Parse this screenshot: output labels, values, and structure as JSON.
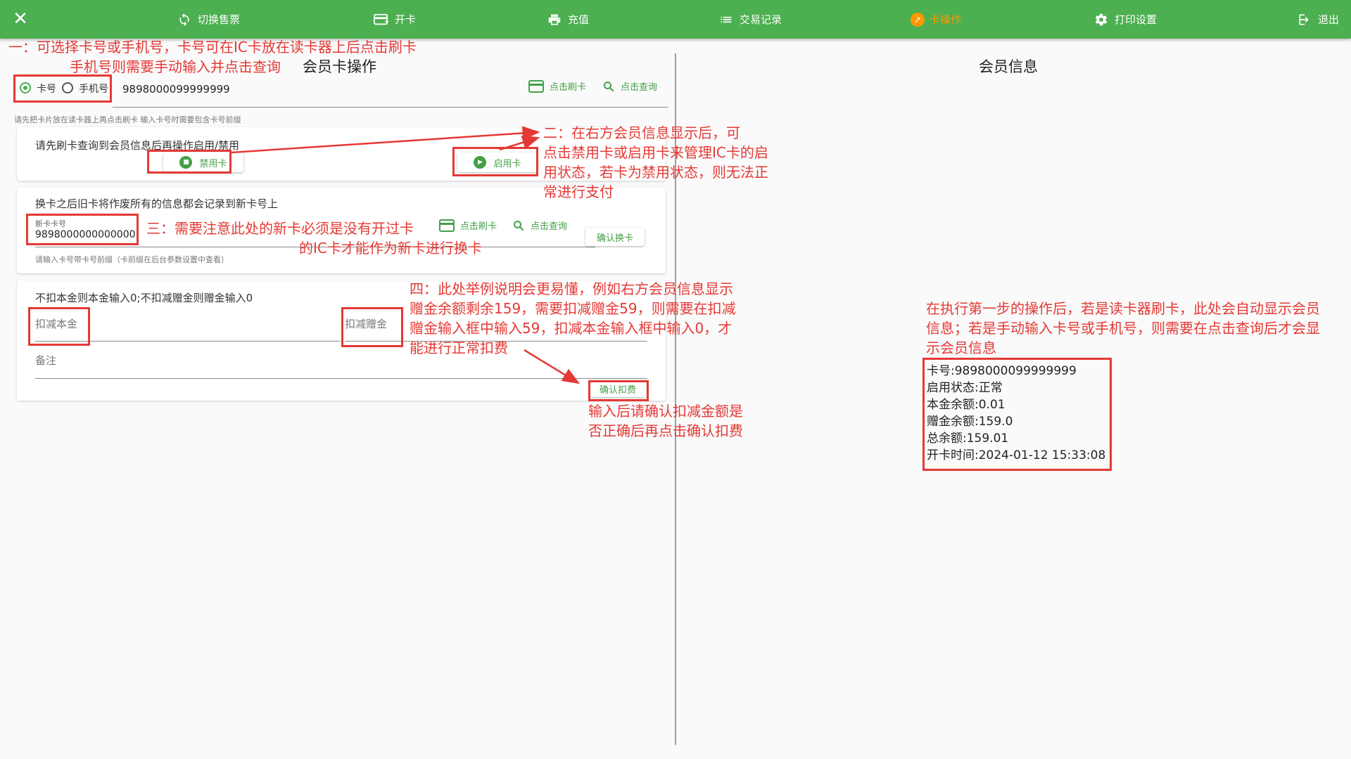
{
  "topbar": {
    "bg": "#4caf50",
    "nav": [
      {
        "label": "切换售票",
        "icon": "refresh-icon"
      },
      {
        "label": "开卡",
        "icon": "card-add-icon"
      },
      {
        "label": "充值",
        "icon": "printer-icon"
      },
      {
        "label": "交易记录",
        "icon": "list-icon"
      },
      {
        "label": "卡操作",
        "icon": "card-operation-icon",
        "active": true
      },
      {
        "label": "打印设置",
        "icon": "gear-icon"
      },
      {
        "label": "退出",
        "icon": "logout-icon"
      }
    ]
  },
  "left": {
    "title": "会员卡操作",
    "search": {
      "radio_card": "卡号",
      "radio_phone": "手机号",
      "value": "9898000099999999",
      "swipe": "点击刷卡",
      "query": "点击查询",
      "hint": "请先把卡片放在读卡器上再点击刷卡 输入卡号时需要包含卡号前缀"
    },
    "status_card": {
      "desc": "请先刷卡查询到会员信息后再操作启用/禁用",
      "disable_btn": "禁用卡",
      "enable_btn": "启用卡"
    },
    "replace_card": {
      "desc": "换卡之后旧卡将作废所有的信息都会记录到新卡号上",
      "new_label": "新卡卡号",
      "new_value": "9898000000000000",
      "swipe": "点击刷卡",
      "query": "点击查询",
      "confirm": "确认换卡",
      "hint": "请输入卡号带卡号前缀（卡前缀在后台参数设置中查看）"
    },
    "deduct_card": {
      "desc": "不扣本金则本金输入0;不扣减赠金则赠金输入0",
      "principal_label": "扣减本金",
      "gift_label": "扣减赠金",
      "remark_label": "备注",
      "confirm": "确认扣费"
    }
  },
  "right": {
    "title": "会员信息",
    "info": [
      "卡号:9898000099999999",
      "启用状态:正常",
      "本金余额:0.01",
      "赠金余额:159.0",
      "总余额:159.01",
      "开卡时间:2024-01-12 15:33:08"
    ]
  },
  "annotations": {
    "a1_line1": "一：可选择卡号或手机号，卡号可在IC卡放在读卡器上后点击刷卡",
    "a1_line2": "手机号则需要手动输入并点击查询",
    "a2_lines": [
      "二：在右方会员信息显示后，可",
      "点击禁用卡或启用卡来管理IC卡的启",
      "用状态，若卡为禁用状态，则无法正",
      "常进行支付"
    ],
    "a3_line1": "三：需要注意此处的新卡必须是没有开过卡",
    "a3_line2": "的IC卡才能作为新卡进行换卡",
    "a4_lines": [
      "四：此处举例说明会更易懂，例如右方会员信息显示",
      "赠金余额剩余159，需要扣减赠金59，则需要在扣减",
      "赠金输入框中输入59，扣减本金输入框中输入0，才",
      "能进行正常扣费"
    ],
    "a5_lines": [
      "输入后请确认扣减金额是",
      "否正确后再点击确认扣费"
    ],
    "a6_lines": [
      "在执行第一步的操作后，若是读卡器刷卡，此处会自动显示会员",
      "信息；若是手动输入卡号或手机号，则需要在点击查询后才会显",
      "示会员信息"
    ]
  }
}
